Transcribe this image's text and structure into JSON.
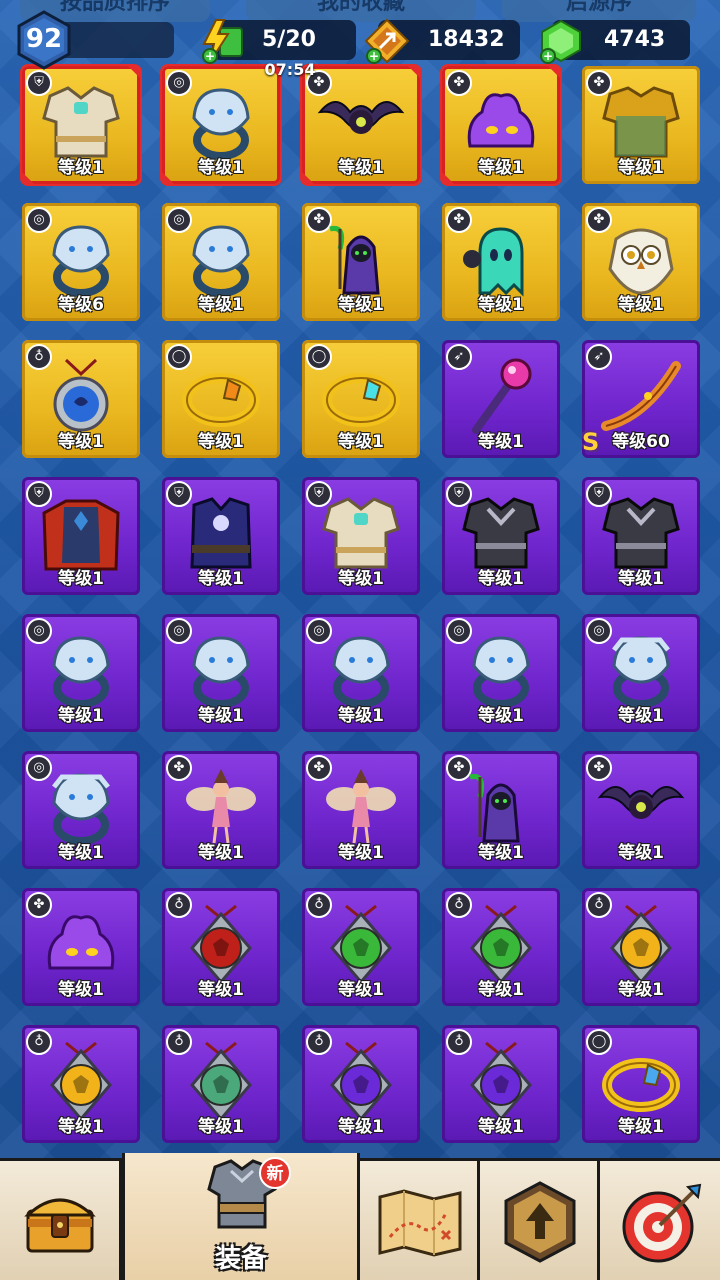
{
  "tabs": [
    {
      "label": "按品质排序"
    },
    {
      "label": "我的收藏"
    },
    {
      "label": "启源序"
    }
  ],
  "player": {
    "level": "92"
  },
  "resources": {
    "energy": "5/20",
    "energy_timer": "07:54",
    "gold": "18432",
    "gems": "4743"
  },
  "colors": {
    "gold_tier": "#eab820",
    "purple_tier": "#6f25cc",
    "new_marker": "#e3342e",
    "selected_frame": "#d72020"
  },
  "items": [
    {
      "type": "armor",
      "tier": "gold",
      "level": "等级1",
      "selected": true,
      "art": "armor-gold"
    },
    {
      "type": "ring",
      "tier": "gold",
      "level": "等级1",
      "selected": true,
      "art": "ring-lion"
    },
    {
      "type": "pet",
      "tier": "gold",
      "level": "等级1",
      "selected": true,
      "art": "bat"
    },
    {
      "type": "pet",
      "tier": "gold",
      "level": "等级1",
      "selected": true,
      "art": "slime"
    },
    {
      "type": "pet",
      "tier": "gold",
      "level": "等级1",
      "selected": false,
      "art": "armor-knight"
    },
    {
      "type": "ring",
      "tier": "gold",
      "level": "等级6",
      "selected": false,
      "art": "ring-bear"
    },
    {
      "type": "ring",
      "tier": "gold",
      "level": "等级1",
      "selected": false,
      "art": "ring-wolf"
    },
    {
      "type": "pet",
      "tier": "gold",
      "level": "等级1",
      "selected": false,
      "art": "reaper"
    },
    {
      "type": "pet",
      "tier": "gold",
      "level": "等级1",
      "selected": false,
      "art": "ghost"
    },
    {
      "type": "pet",
      "tier": "gold",
      "level": "等级1",
      "selected": false,
      "art": "owl"
    },
    {
      "type": "amulet",
      "tier": "gold",
      "level": "等级1",
      "selected": false,
      "art": "amulet-moon"
    },
    {
      "type": "bracelet",
      "tier": "gold",
      "level": "等级1",
      "selected": false,
      "art": "bracelet-amber"
    },
    {
      "type": "bracelet",
      "tier": "gold",
      "level": "等级1",
      "selected": false,
      "art": "bracelet-cyan"
    },
    {
      "type": "weapon",
      "tier": "purple",
      "level": "等级1",
      "selected": false,
      "art": "staff"
    },
    {
      "type": "weapon",
      "tier": "purple",
      "level": "等级60",
      "selected": false,
      "art": "bow",
      "rank": "S"
    },
    {
      "type": "armor",
      "tier": "purple",
      "level": "等级1",
      "selected": false,
      "art": "armor-cape"
    },
    {
      "type": "armor",
      "tier": "purple",
      "level": "等级1",
      "selected": false,
      "art": "armor-robe"
    },
    {
      "type": "armor",
      "tier": "purple",
      "level": "等级1",
      "selected": false,
      "art": "armor-gold"
    },
    {
      "type": "armor",
      "tier": "purple",
      "level": "等级1",
      "selected": false,
      "art": "armor-dark"
    },
    {
      "type": "armor",
      "tier": "purple",
      "level": "等级1",
      "selected": false,
      "art": "armor-dark"
    },
    {
      "type": "ring",
      "tier": "purple",
      "level": "等级1",
      "selected": false,
      "art": "ring-wolf"
    },
    {
      "type": "ring",
      "tier": "purple",
      "level": "等级1",
      "selected": false,
      "art": "ring-wolf"
    },
    {
      "type": "ring",
      "tier": "purple",
      "level": "等级1",
      "selected": false,
      "art": "ring-eagle"
    },
    {
      "type": "ring",
      "tier": "purple",
      "level": "等级1",
      "selected": false,
      "art": "ring-eagle"
    },
    {
      "type": "ring",
      "tier": "purple",
      "level": "等级1",
      "selected": false,
      "art": "ring-bull"
    },
    {
      "type": "ring",
      "tier": "purple",
      "level": "等级1",
      "selected": false,
      "art": "ring-bull"
    },
    {
      "type": "pet",
      "tier": "purple",
      "level": "等级1",
      "selected": false,
      "art": "fairy"
    },
    {
      "type": "pet",
      "tier": "purple",
      "level": "等级1",
      "selected": false,
      "art": "fairy"
    },
    {
      "type": "pet",
      "tier": "purple",
      "level": "等级1",
      "selected": false,
      "art": "reaper"
    },
    {
      "type": "pet",
      "tier": "purple",
      "level": "等级1",
      "selected": false,
      "art": "bat"
    },
    {
      "type": "pet",
      "tier": "purple",
      "level": "等级1",
      "selected": false,
      "art": "slime"
    },
    {
      "type": "amulet",
      "tier": "purple",
      "level": "等级1",
      "selected": false,
      "art": "amulet-wolf"
    },
    {
      "type": "amulet",
      "tier": "purple",
      "level": "等级1",
      "selected": false,
      "art": "amulet-green"
    },
    {
      "type": "amulet",
      "tier": "purple",
      "level": "等级1",
      "selected": false,
      "art": "amulet-green"
    },
    {
      "type": "amulet",
      "tier": "purple",
      "level": "等级1",
      "selected": false,
      "art": "amulet-lion"
    },
    {
      "type": "amulet",
      "tier": "purple",
      "level": "等级1",
      "selected": false,
      "art": "amulet-lion"
    },
    {
      "type": "amulet",
      "tier": "purple",
      "level": "等级1",
      "selected": false,
      "art": "amulet-monkey"
    },
    {
      "type": "amulet",
      "tier": "purple",
      "level": "等级1",
      "selected": false,
      "art": "amulet-bat"
    },
    {
      "type": "amulet",
      "tier": "purple",
      "level": "等级1",
      "selected": false,
      "art": "amulet-bat"
    },
    {
      "type": "bracelet",
      "tier": "purple",
      "level": "等级1",
      "selected": false,
      "art": "bracelet-ice"
    }
  ],
  "nav": [
    {
      "id": "chest",
      "label": "",
      "icon": "chest-icon",
      "active": false
    },
    {
      "id": "equip",
      "label": "装备",
      "icon": "armor-icon",
      "active": true,
      "badge": "新"
    },
    {
      "id": "map",
      "label": "",
      "icon": "map-icon",
      "active": false
    },
    {
      "id": "upgrade",
      "label": "",
      "icon": "upgrade-icon",
      "active": false
    },
    {
      "id": "target",
      "label": "",
      "icon": "target-icon",
      "active": false
    }
  ]
}
